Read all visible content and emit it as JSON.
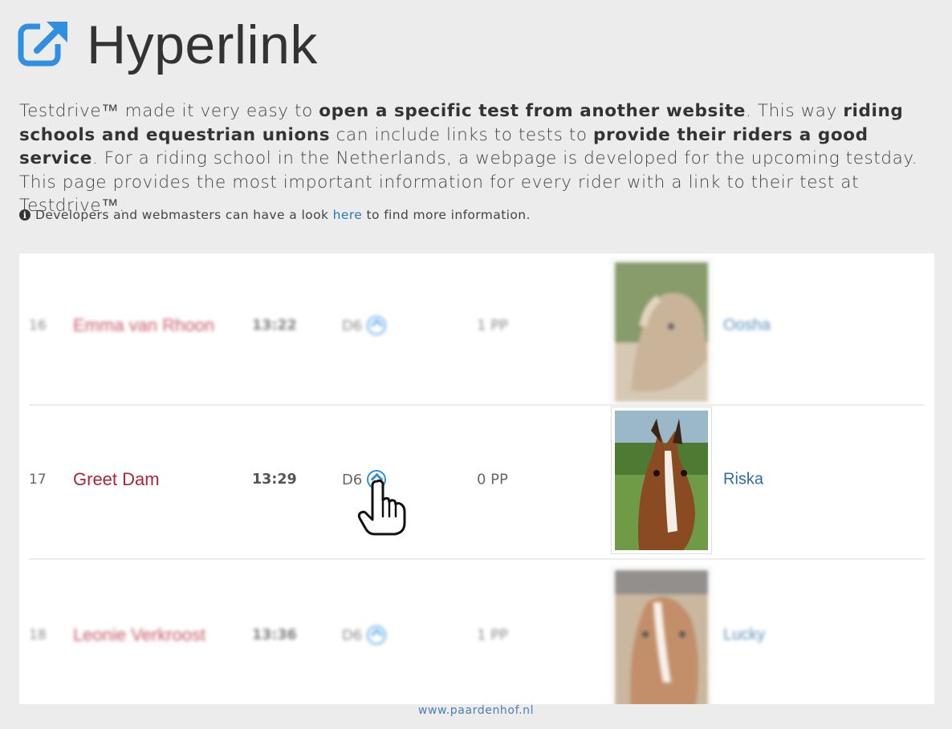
{
  "header": {
    "icon": "external-link-icon",
    "title": "Hyperlink",
    "accent": "#2f8fe0"
  },
  "intro": {
    "p1": "Testdrive™ made it very easy to ",
    "b1": "open a specific test from another website",
    "p2": ". This way ",
    "b2": "riding schools and equestrian unions",
    "p3": " can include links to tests to ",
    "b3": "provide their riders a good service",
    "p4": ". For a riding school in the Netherlands, a webpage is developed for the upcoming testday. This page provides the most important information for every rider with a link to their test at Testdrive™."
  },
  "note": {
    "icon": "info-icon",
    "before": "Developers and webmasters can have a look ",
    "link": "here",
    "after": " to find more information."
  },
  "rows": [
    {
      "num": "16",
      "rider": "Emma van Rhoon",
      "time": "13:22",
      "test": "D6",
      "pp": "1 PP",
      "horse": "Oosha",
      "blurred": true
    },
    {
      "num": "17",
      "rider": "Greet Dam",
      "time": "13:29",
      "test": "D6",
      "pp": "0 PP",
      "horse": "Riska",
      "blurred": false
    },
    {
      "num": "18",
      "rider": "Leonie Verkroost",
      "time": "13:36",
      "test": "D6",
      "pp": "1 PP",
      "horse": "Lucky",
      "blurred": true
    }
  ],
  "footer": {
    "site": "www.paardenhof.nl"
  },
  "colors": {
    "rider": "#b22335",
    "horse": "#2a6ea8",
    "link": "#2a7ab8"
  }
}
